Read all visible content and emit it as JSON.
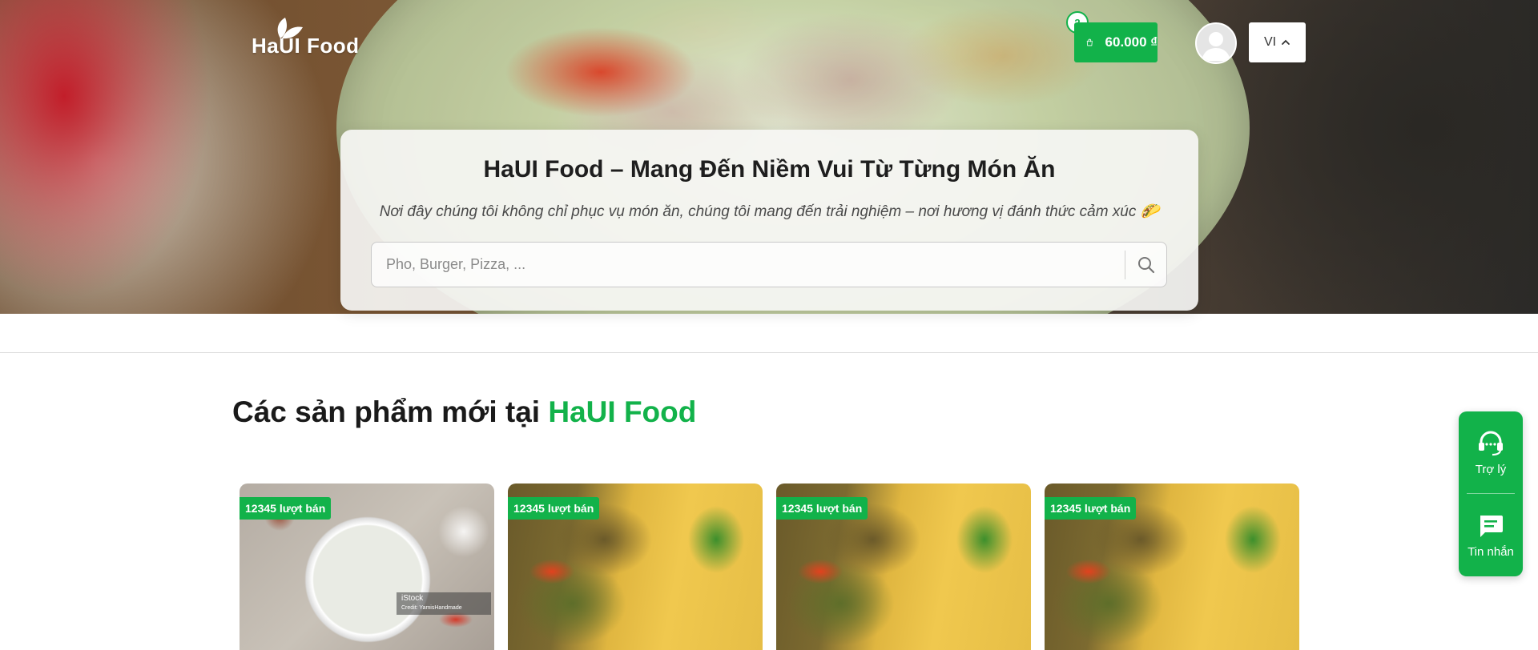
{
  "header": {
    "logo_text": "HaUI Food",
    "cart": {
      "count": "2",
      "total": "60.000 ₫"
    },
    "language": "VI"
  },
  "hero": {
    "title": "HaUI Food – Mang Đến Niềm Vui Từ Từng Món Ăn",
    "subtitle": "Nơi đây chúng tôi không chỉ phục vụ món ăn, chúng tôi mang đến trải nghiệm – nơi hương vị đánh thức cảm xúc 🌮",
    "search": {
      "placeholder": "Pho, Burger, Pizza, ...",
      "value": ""
    }
  },
  "products_section": {
    "title_prefix": "Các sản phẩm mới tại",
    "title_brand": "HaUI Food",
    "items": [
      {
        "sold_label": "12345 lượt bán",
        "watermark": "iStock",
        "watermark_credit": "Credit: YamisHandmade"
      },
      {
        "sold_label": "12345 lượt bán"
      },
      {
        "sold_label": "12345 lượt bán"
      },
      {
        "sold_label": "12345 lượt bán"
      }
    ]
  },
  "support": {
    "assistant_label": "Trợ lý",
    "messages_label": "Tin nhắn"
  },
  "colors": {
    "brand_green": "#12b24a"
  },
  "icons": [
    "leaf-logo-icon",
    "shopping-bag-icon",
    "user-avatar-icon",
    "chevron-up-icon",
    "search-icon",
    "headset-icon",
    "chat-icon"
  ]
}
